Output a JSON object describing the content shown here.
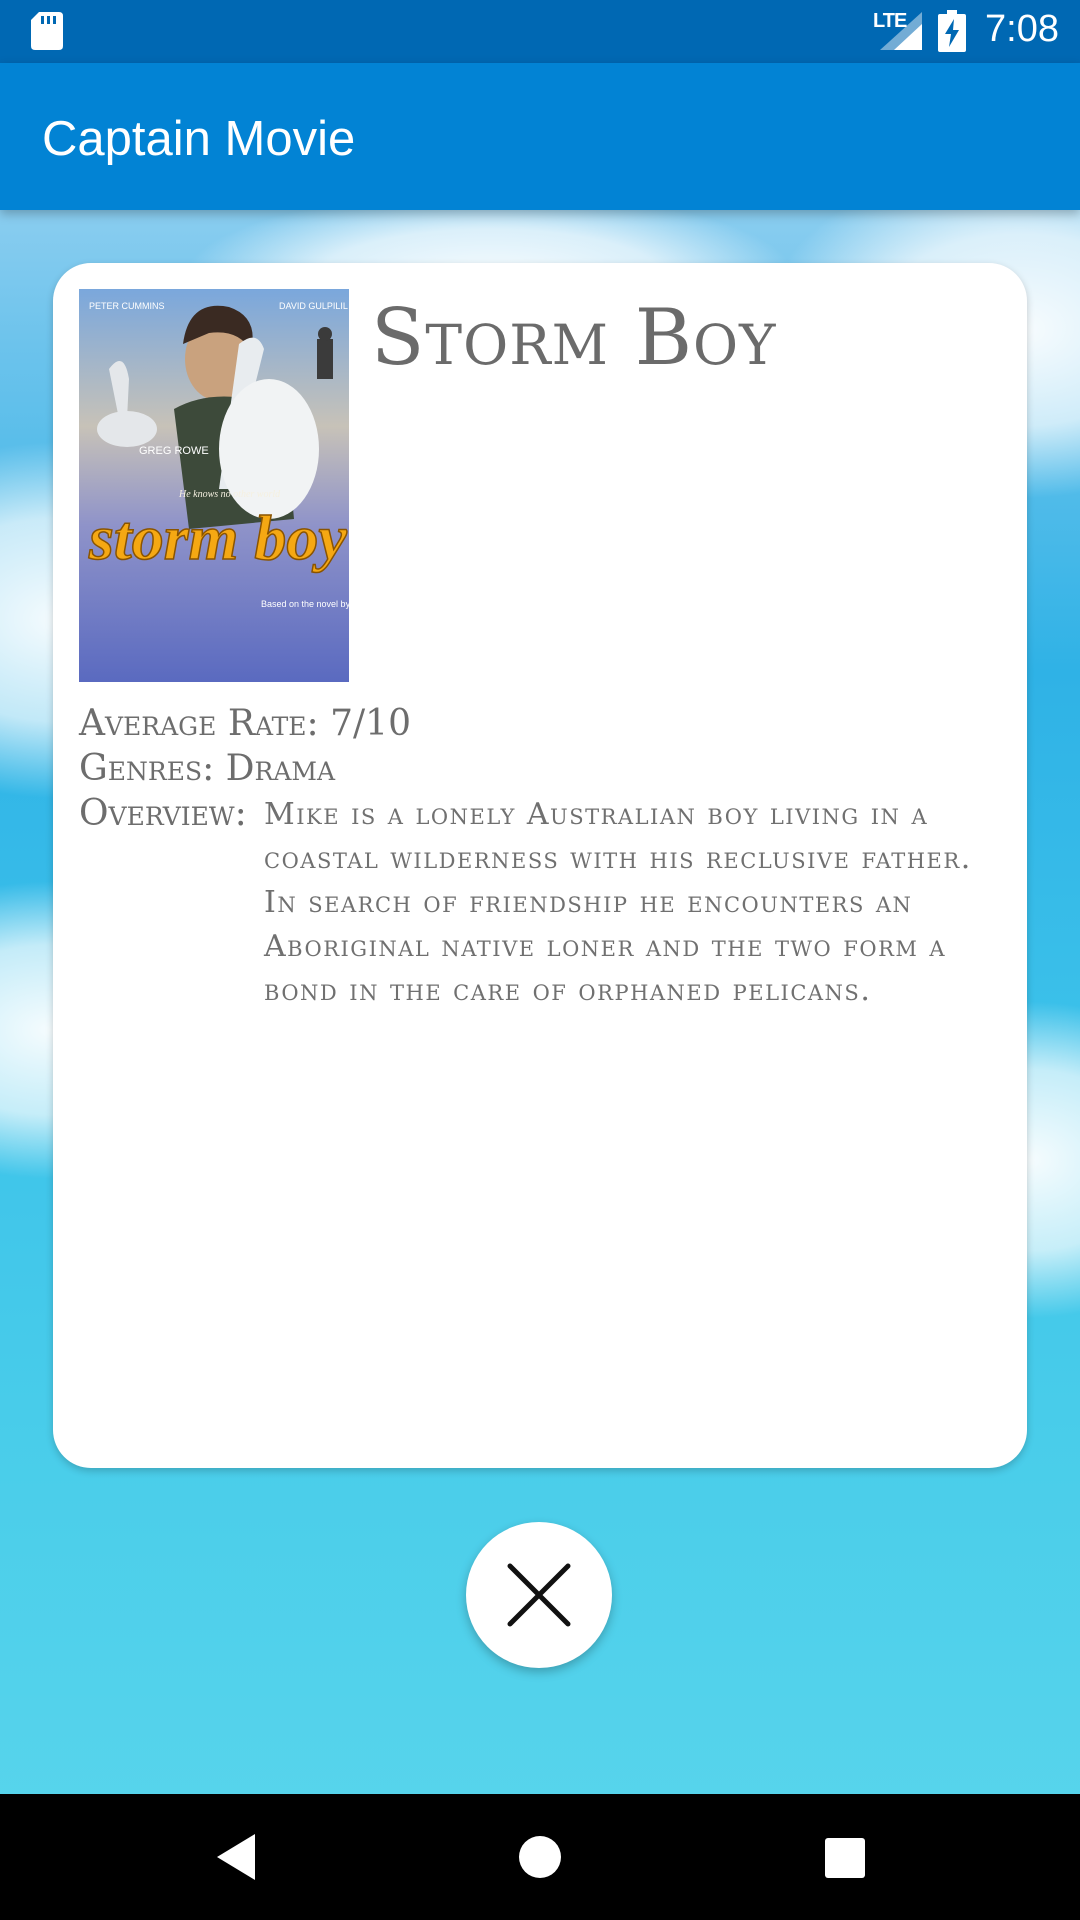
{
  "status_bar": {
    "network_label": "LTE",
    "time": "7:08",
    "icons": [
      "sd-card-icon",
      "signal-icon",
      "battery-charging-icon"
    ]
  },
  "app_bar": {
    "title": "Captain Movie"
  },
  "movie": {
    "title": "Storm Boy",
    "average_rate_text": "Average Rate: 7/10",
    "genres_text": "Genres: Drama",
    "overview_label": "Overview:",
    "overview": "Mike is a lonely Australian boy living in a coastal wilderness with his reclusive father. In search of friendship he encounters an Aboriginal native loner and the two form a bond in the care of orphaned pelicans.",
    "poster": {
      "top_left_name": "PETER CUMMINS",
      "top_right_name": "DAVID GULPILIL",
      "center_name": "GREG ROWE",
      "tagline": "He knows no other world",
      "logo_text": "storm boy",
      "credit": "Based on the novel by Colin Thiele"
    }
  },
  "close_button": {
    "icon": "close-icon"
  },
  "nav_bar": {
    "icons": [
      "back-icon",
      "home-icon",
      "recents-icon"
    ]
  },
  "colors": {
    "status_bar": "#0068b3",
    "app_bar": "#0283d4",
    "card": "#ffffff",
    "text_gray": "#6d6d6d"
  }
}
